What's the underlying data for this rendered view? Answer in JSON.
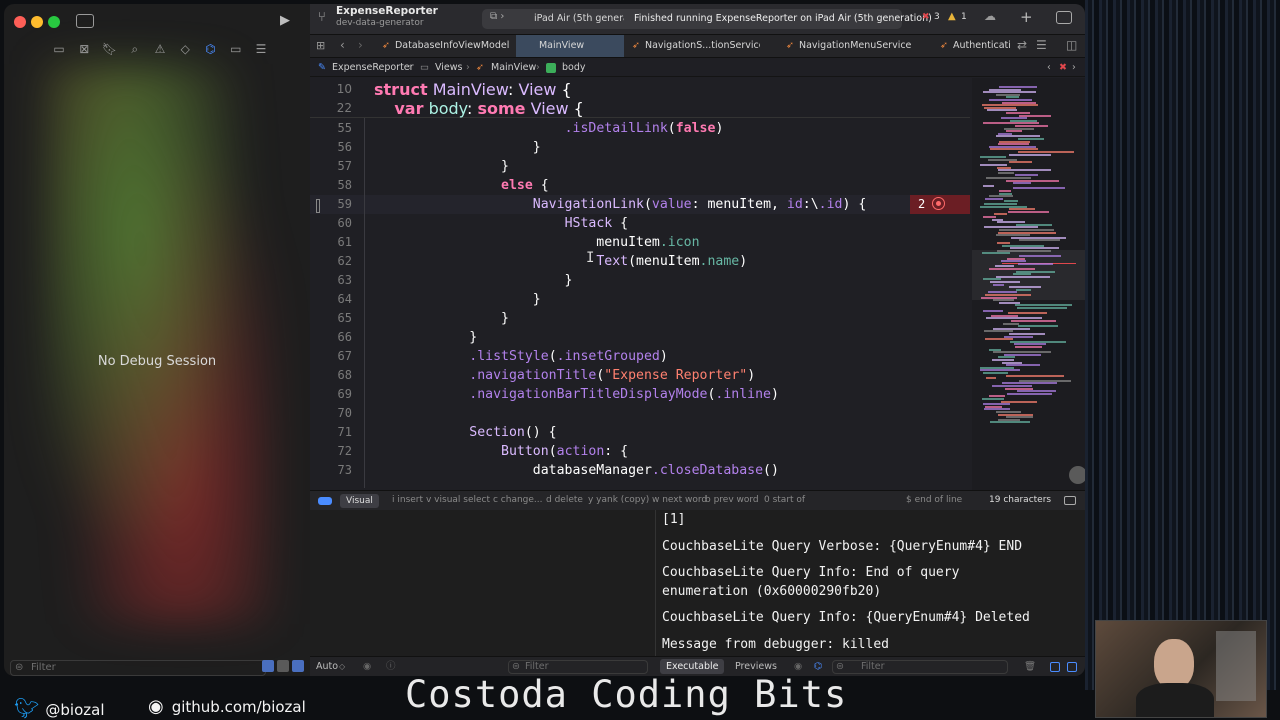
{
  "window": {
    "project_name": "ExpenseReporter",
    "scheme": "dev-data-generator",
    "destination": "iPad Air (5th genera",
    "status": "Finished running ExpenseReporter on iPad Air (5th generation)",
    "error_count": "3",
    "warning_count": "1"
  },
  "debug_navigator": {
    "message": "No Debug Session",
    "filter_placeholder": "Filter"
  },
  "tabs": [
    {
      "label": "DatabaseInfoViewModel"
    },
    {
      "label": "MainView"
    },
    {
      "label": "NavigationS...tionService"
    },
    {
      "label": "NavigationMenuService"
    },
    {
      "label": "Authenticati"
    }
  ],
  "jumpbar": {
    "crumbs": [
      "ExpenseReporter",
      "Views",
      "MainView",
      "body"
    ]
  },
  "code": {
    "sticky": [
      {
        "n": "10",
        "text": "struct MainView: View {"
      },
      {
        "n": "22",
        "text": "    var body: some View {"
      }
    ],
    "lines": [
      {
        "n": "55",
        "text": "                        .isDetailLink(false)"
      },
      {
        "n": "56",
        "text": "                    }"
      },
      {
        "n": "57",
        "text": "                }"
      },
      {
        "n": "58",
        "text": "                else {"
      },
      {
        "n": "59",
        "text": "                    NavigationLink(value: menuItem, id:\\.id) {"
      },
      {
        "n": "60",
        "text": "                        HStack {"
      },
      {
        "n": "61",
        "text": "                            menuItem.icon"
      },
      {
        "n": "62",
        "text": "                            Text(menuItem.name)"
      },
      {
        "n": "63",
        "text": "                        }"
      },
      {
        "n": "64",
        "text": "                    }"
      },
      {
        "n": "65",
        "text": "                }"
      },
      {
        "n": "66",
        "text": "            }"
      },
      {
        "n": "67",
        "text": "            .listStyle(.insetGrouped)"
      },
      {
        "n": "68",
        "text": "            .navigationTitle(\"Expense Reporter\")"
      },
      {
        "n": "69",
        "text": "            .navigationBarTitleDisplayMode(.inline)"
      },
      {
        "n": "70",
        "text": ""
      },
      {
        "n": "71",
        "text": "            Section() {"
      },
      {
        "n": "72",
        "text": "                Button(action: {"
      },
      {
        "n": "73",
        "text": "                    databaseManager.closeDatabase()"
      }
    ],
    "error_badge": "2"
  },
  "vim_bar": {
    "mode": "Visual",
    "hints": [
      "i insert",
      "v visual select",
      "c change...",
      "d delete",
      "y yank (copy)",
      "w next word",
      "b prev word",
      "0 start of line",
      "$ end of line"
    ],
    "selection": "19 characters"
  },
  "console": {
    "lines": [
      "[1]",
      "CouchbaseLite Query Verbose: {QueryEnum#4} END",
      "CouchbaseLite Query Info: End of query",
      "enumeration (0x60000290fb20)",
      "CouchbaseLite Query Info: {QueryEnum#4} Deleted",
      "Message from debugger: killed"
    ],
    "highlight_color": "#4b5d3c"
  },
  "bottom_bar": {
    "auto_label": "Auto",
    "filter_placeholder": "Filter",
    "executable_label": "Executable",
    "previews_label": "Previews",
    "filter2_placeholder": "Filter"
  },
  "overlay": {
    "twitter_handle": "@biozal",
    "github_url": "github.com/biozal",
    "banner": "Costoda Coding Bits"
  },
  "colors": {
    "keyword": "#ff7ab2",
    "type": "#dabaff",
    "function": "#b281eb",
    "property": "#67b7a4",
    "string": "#ff8170",
    "error": "#e0474c"
  }
}
